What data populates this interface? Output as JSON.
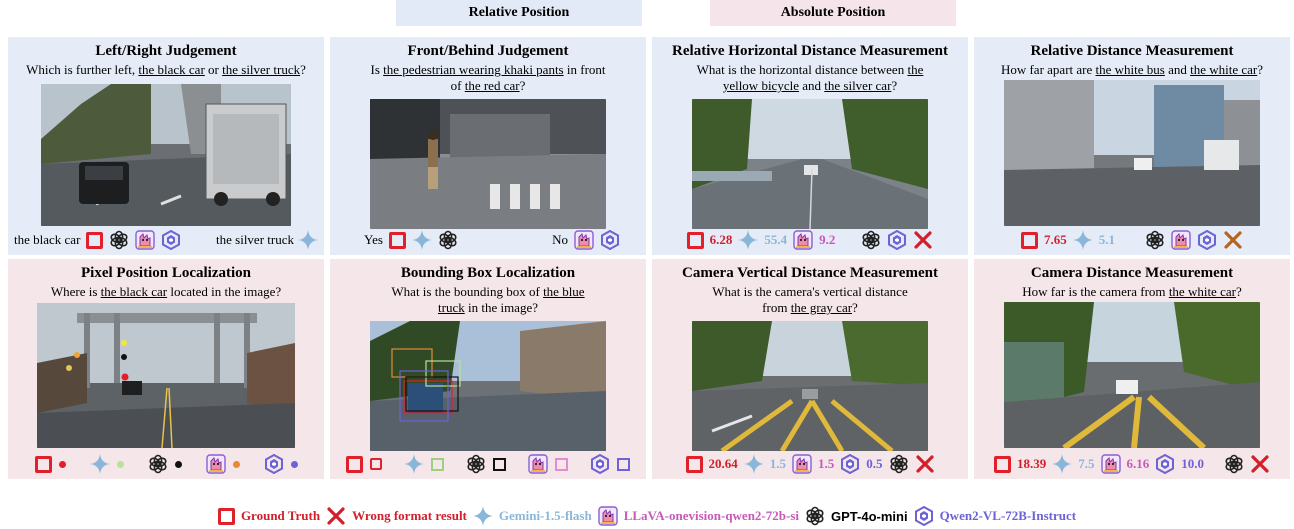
{
  "header": {
    "relative": "Relative Position",
    "absolute": "Absolute Position"
  },
  "panels": {
    "p1": {
      "title": "Left/Right Judgement",
      "q_pre": "Which is further left, ",
      "q_u1": "the black car",
      "q_mid": " or ",
      "q_u2": "the silver truck",
      "q_post": "?",
      "ans_left": "the black car",
      "ans_right": "the silver truck"
    },
    "p2": {
      "title": "Front/Behind Judgement",
      "q_pre": "Is ",
      "q_u1": "the pedestrian wearing khaki pants",
      "q_mid": " in front of ",
      "q_u2": "the red car",
      "q_post": "?",
      "ans_yes": "Yes",
      "ans_no": "No"
    },
    "p3": {
      "title": "Relative Horizontal Distance Measurement",
      "q_pre": "What is the horizontal distance between ",
      "q_u1": "the yellow bicycle",
      "q_mid": " and ",
      "q_u2": "the silver car",
      "q_post": "?",
      "gt": "6.28",
      "gemini": "55.4",
      "llava": "9.2"
    },
    "p4": {
      "title": "Relative Distance Measurement",
      "q_pre": "How far apart are ",
      "q_u1": "the white bus",
      "q_mid": " and ",
      "q_u2": "the white car",
      "q_post": "?",
      "gt": "7.65",
      "gemini": "5.1"
    },
    "p5": {
      "title": "Pixel Position Localization",
      "q_pre": "Where is ",
      "q_u1": "the black car",
      "q_post": " located in the image?"
    },
    "p6": {
      "title": "Bounding Box Localization",
      "q_pre": "What is the bounding box of ",
      "q_u1": "the blue truck",
      "q_post": " in the image?"
    },
    "p7": {
      "title": "Camera Vertical Distance Measurement",
      "q_pre": "What is the camera's vertical distance from ",
      "q_u1": "the gray car",
      "q_post": "?",
      "gt": "20.64",
      "gemini": "1.5",
      "llava": "1.5",
      "qwen": "0.5"
    },
    "p8": {
      "title": "Camera Distance Measurement",
      "q_pre": "How far is the camera from ",
      "q_u1": "the white car",
      "q_post": "?",
      "gt": "18.39",
      "gemini": "7.5",
      "llava": "6.16",
      "qwen": "10.0"
    }
  },
  "legend": {
    "gt": "Ground Truth",
    "wrong": "Wrong format result",
    "gemini": "Gemini-1.5-flash",
    "llava": "LLaVA-onevision-qwen2-72b-si",
    "gpt": "GPT-4o-mini",
    "qwen": "Qwen2-VL-72B-Instruct"
  },
  "colors": {
    "relative_bg": "#e6ecf7",
    "absolute_bg": "#f5e6ea",
    "gt_red": "#e0202a",
    "gemini_blue": "#8ab7d9",
    "llava_pink": "#c75ab9",
    "qwen_purple": "#6d62d6"
  },
  "icons": [
    "square-gt-icon",
    "x-wrong-icon",
    "gemini-star-icon",
    "llava-icon",
    "gpt-knot-icon",
    "qwen-icon"
  ]
}
